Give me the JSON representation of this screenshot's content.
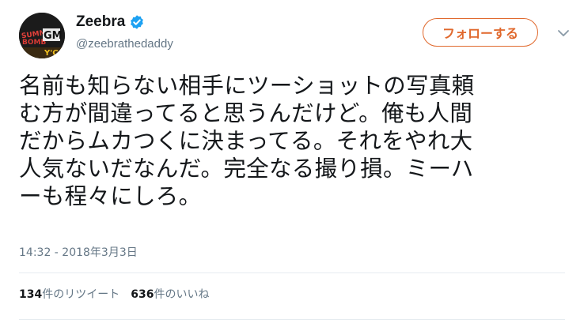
{
  "user": {
    "display_name": "Zeebra",
    "handle": "@zeebrathedaddy",
    "avatar_text": "SUMMER BOMB GM"
  },
  "follow_button": {
    "label": "フォローする"
  },
  "tweet": {
    "lines": [
      "名前も知らない相手にツーショットの写真頼",
      "む方が間違ってると思うんだけど。俺も人間",
      "だからムカつくに決まってる。それをやれ大",
      "人気ないだなんだ。完全なる撮り損。ミーハ",
      "ーも程々にしろ。"
    ],
    "timestamp": "14:32 - 2018年3月3日"
  },
  "stats": {
    "retweets_count": "134",
    "retweets_label": "件のリツイート",
    "likes_count": "636",
    "likes_label": "件のいいね"
  },
  "colors": {
    "follow_accent": "#e0682c",
    "verified_blue": "#1da1f2",
    "secondary_text": "#657786"
  },
  "icons": [
    "verified-badge-icon",
    "chevron-down-icon"
  ]
}
